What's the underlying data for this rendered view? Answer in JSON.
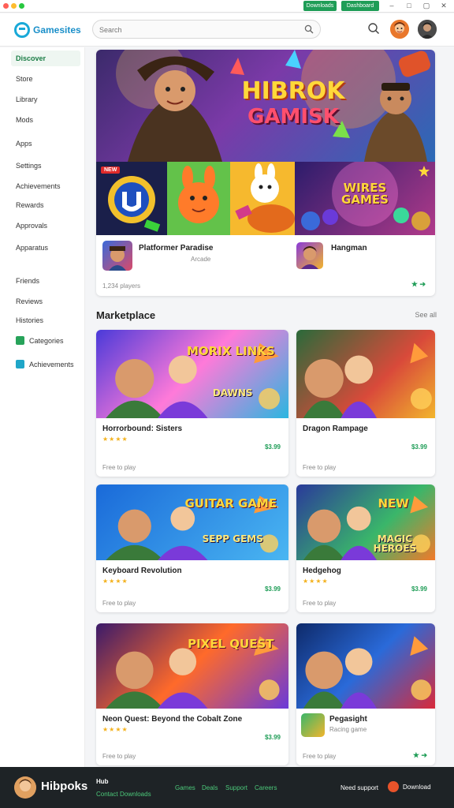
{
  "window": {
    "btn1": "Downloads",
    "btn2": "Dashboard"
  },
  "header": {
    "logo": "Gamesites",
    "search_placeholder": "Search"
  },
  "sidebar": [
    {
      "label": "Discover",
      "active": true
    },
    {
      "label": "Store"
    },
    {
      "label": "Library"
    },
    {
      "label": "Mods"
    },
    {
      "label": "Apps"
    },
    {
      "label": "Settings"
    },
    {
      "label": "Achievements"
    },
    {
      "label": "Rewards"
    },
    {
      "label": "Approvals"
    },
    {
      "label": "Apparatus"
    },
    {
      "label": "Friends"
    },
    {
      "label": "Reviews"
    },
    {
      "label": "Histories"
    },
    {
      "label": "Categories",
      "icon_color": "#27a35a"
    },
    {
      "label": "Achievements",
      "icon_color": "#1fa6c8"
    }
  ],
  "hero": {
    "title_line1": "HIBROK",
    "title_line2": "GAMISK",
    "promo": "WIRES GAMES",
    "badge": "NEW",
    "item1": "Platformer Paradise",
    "item1_sub": "Arcade",
    "item2": "Hangman",
    "meta": "1,234 players"
  },
  "section": {
    "title": "Marketplace",
    "link": "See all"
  },
  "grid": [
    {
      "art": "MORIX LINKS",
      "art_sub": "DAWNS",
      "title": "Horrorbound: Sisters",
      "stars": "★★★★",
      "price": "$3.99",
      "meta": "Free to play"
    },
    {
      "art": "",
      "art_sub": "",
      "title": "Dragon Rampage",
      "stars": "",
      "price": "$3.99",
      "meta": "Free to play"
    },
    {
      "art": "GUITAR GAME",
      "art_sub": "SEPP GEMS",
      "title": "Keyboard Revolution",
      "stars": "★★★★",
      "price": "$3.99",
      "meta": "Free to play"
    },
    {
      "art": "NEW",
      "art_sub": "MAGIC HEROES",
      "title": "Hedgehog",
      "stars": "★★★★",
      "price": "$3.99",
      "meta": "Free to play"
    },
    {
      "art": "PIXEL QUEST",
      "art_sub": "",
      "title": "Neon Quest: Beyond the Cobalt Zone",
      "stars": "★★★★",
      "price": "$3.99",
      "meta": "Free to play"
    },
    {
      "art": "",
      "art_sub": "",
      "title": "Pegasight",
      "stars": "",
      "price": "",
      "sub": "Racing game",
      "meta": "Free to play"
    }
  ],
  "footer": {
    "brand": "Hibpoks",
    "col1": "Hub",
    "col1_sub": "Contact",
    "col1_sub2": "Downloads",
    "links": [
      "Games",
      "Deals",
      "Support",
      "Careers"
    ],
    "right": "Need support",
    "cta": "Download"
  },
  "colors": {
    "accent": "#1f9d57",
    "brand": "#1a8fc9"
  }
}
